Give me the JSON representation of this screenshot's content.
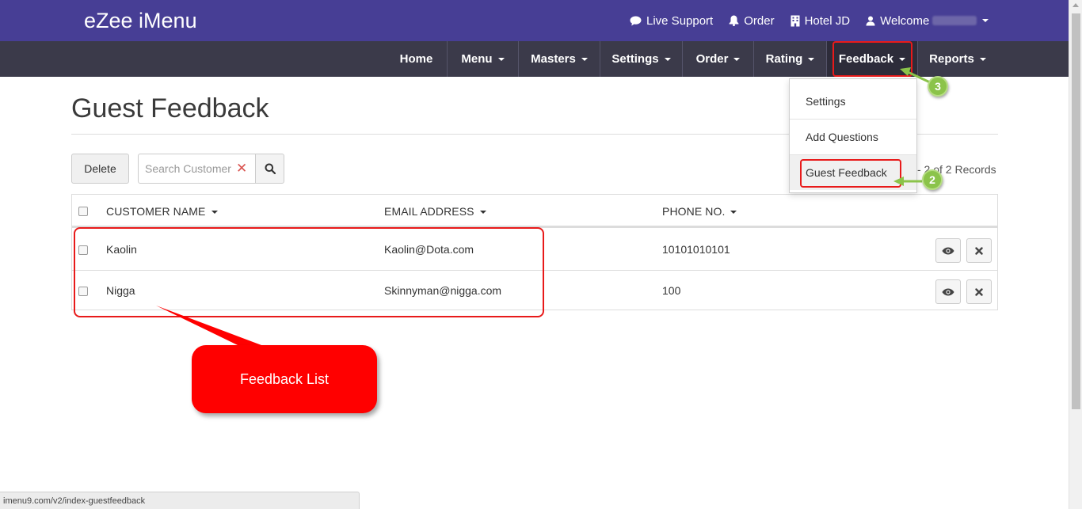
{
  "header": {
    "brand": "eZee iMenu",
    "links": {
      "live_support": "Live Support",
      "order": "Order",
      "hotel": "Hotel JD",
      "welcome": "Welcome"
    }
  },
  "nav": {
    "home": "Home",
    "menu": "Menu",
    "masters": "Masters",
    "settings": "Settings",
    "order": "Order",
    "rating": "Rating",
    "feedback": "Feedback",
    "reports": "Reports"
  },
  "dropdown": {
    "items": [
      "Settings",
      "Add Questions",
      "Guest Feedback"
    ],
    "active_index": 2
  },
  "page": {
    "title": "Guest Feedback",
    "delete_label": "Delete",
    "search_placeholder": "Search Customer",
    "records_text": "- 2 of 2 Records"
  },
  "table": {
    "columns": [
      "CUSTOMER NAME",
      "EMAIL ADDRESS",
      "PHONE NO."
    ],
    "rows": [
      {
        "name": "Kaolin",
        "email": "Kaolin@Dota.com",
        "phone": "10101010101"
      },
      {
        "name": "Nigga",
        "email": "Skinnyman@nigga.com",
        "phone": "100"
      }
    ]
  },
  "annotations": {
    "callout": "Feedback List",
    "step_2": "2",
    "step_3": "3"
  },
  "statusbar": {
    "url": "imenu9.com/v2/index-guestfeedback"
  },
  "colors": {
    "topbar": "#473e95",
    "navbar": "#3b3a4a",
    "highlight": "#e81a1a",
    "badge": "#8bc34a",
    "callout": "#ff0000"
  },
  "icons": [
    "comment-icon",
    "bell-icon",
    "building-icon",
    "user-icon",
    "search-icon",
    "eye-icon",
    "close-icon",
    "caret-down-icon"
  ]
}
